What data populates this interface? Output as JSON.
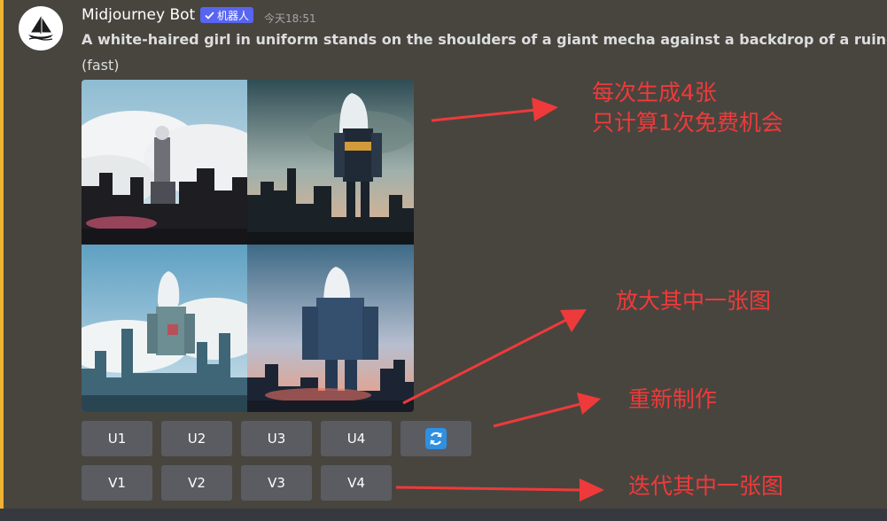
{
  "message": {
    "username": "Midjourney Bot",
    "bot_badge": "机器人",
    "timestamp": "今天18:51",
    "prompt": "A white-haired girl in uniform stands on the shoulders of a giant mecha against a backdrop of a ruined city -",
    "mode": "(fast)"
  },
  "buttons": {
    "upscale": [
      "U1",
      "U2",
      "U3",
      "U4"
    ],
    "variation": [
      "V1",
      "V2",
      "V3",
      "V4"
    ],
    "reroll_icon": "refresh-icon"
  },
  "annotations": {
    "four_images_line1": "每次生成4张",
    "four_images_line2": "只计算1次免费机会",
    "upscale": "放大其中一张图",
    "reroll": "重新制作",
    "variation": "迭代其中一张图"
  },
  "colors": {
    "background": "#48453f",
    "mention_bar": "#f0b232",
    "bot_badge": "#5865f2",
    "button": "#5a5c62",
    "reroll_icon": "#2f8fe0",
    "annotation": "#ee3a3a"
  }
}
